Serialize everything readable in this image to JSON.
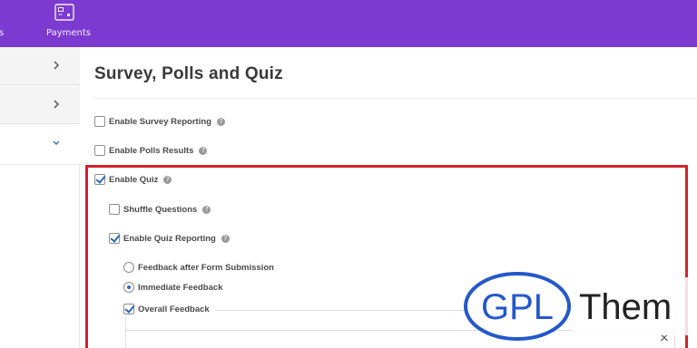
{
  "topbar": {
    "partial_label": "s",
    "payments_label": "Payments",
    "payments_icon": "payments-icon",
    "color": "#7c3ad1"
  },
  "sidebar": {
    "rows": [
      {
        "icon": "chevron-right-icon"
      },
      {
        "icon": "chevron-right-icon"
      },
      {
        "icon": "chevron-down-icon"
      }
    ]
  },
  "main": {
    "title": "Survey, Polls and Quiz",
    "options": {
      "survey_reporting": {
        "label": "Enable Survey Reporting",
        "checked": false
      },
      "polls_results": {
        "label": "Enable Polls Results",
        "checked": false
      },
      "enable_quiz": {
        "label": "Enable Quiz",
        "checked": true
      },
      "shuffle_questions": {
        "label": "Shuffle Questions",
        "checked": false
      },
      "quiz_reporting": {
        "label": "Enable Quiz Reporting",
        "checked": true
      },
      "feedback_after": {
        "label": "Feedback after Form Submission",
        "selected": false
      },
      "immediate_feedback": {
        "label": "Immediate Feedback",
        "selected": true
      },
      "overall_feedback": {
        "label": "Overall Feedback",
        "checked": true
      }
    },
    "help_glyph": "?",
    "close_glyph": "×",
    "highlight_color": "#d4202e"
  },
  "watermark": {
    "text_circle": "GPL",
    "text_right": "Them"
  }
}
